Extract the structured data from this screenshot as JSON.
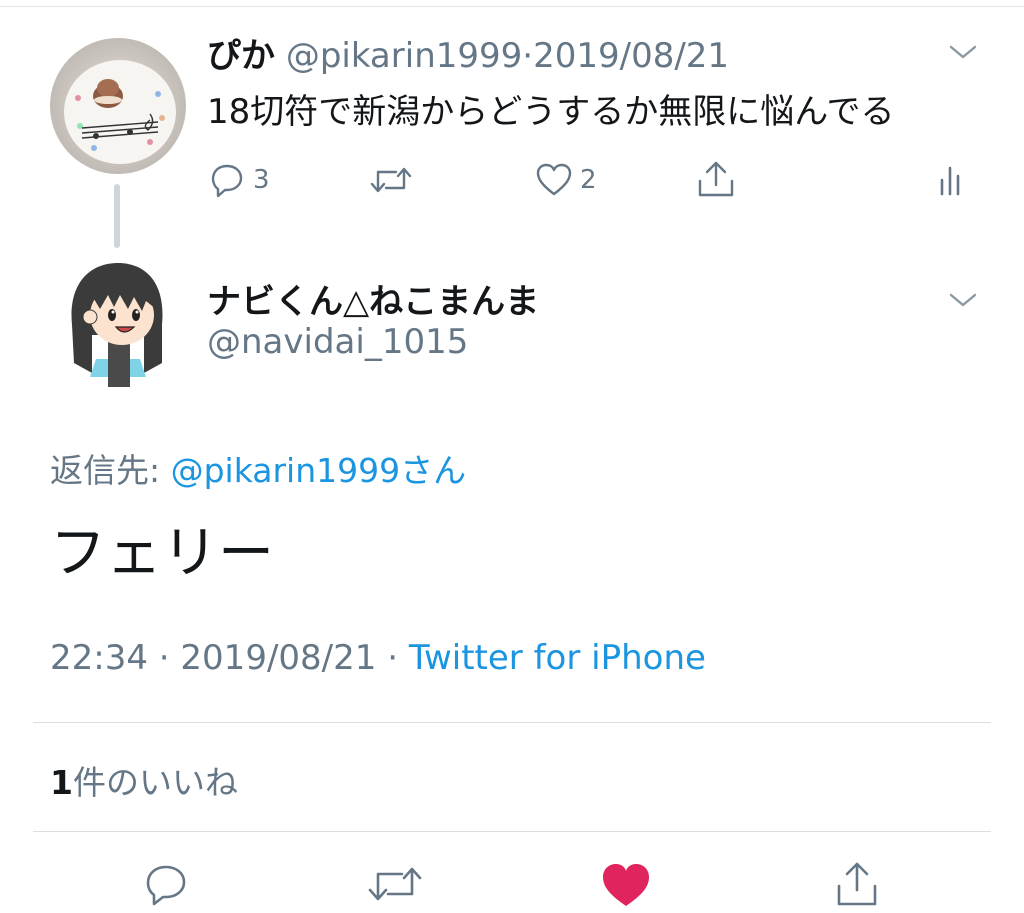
{
  "parent_tweet": {
    "name": "ぴか",
    "handle": "@pikarin1999",
    "separator": "·",
    "date": "2019/08/21",
    "text": "18切符で新潟からどうするか無限に悩んでる",
    "reply_count": "3",
    "like_count": "2"
  },
  "main_tweet": {
    "name": "ナビくん△ねこまんま",
    "handle": "@navidai_1015",
    "reply_prefix": "返信先: ",
    "reply_to": "@pikarin1999さん",
    "text": "フェリー",
    "time": "22:34",
    "separator": " · ",
    "date": "2019/08/21",
    "separator2": " · ",
    "source": "Twitter for iPhone",
    "likes_count": "1",
    "likes_label": "件のいいね"
  },
  "colors": {
    "accent": "#1b95e0",
    "secondary_text": "#657786",
    "like_red": "#e0245e"
  },
  "icons": [
    "chevron-down-icon",
    "reply-icon",
    "retweet-icon",
    "like-icon",
    "share-icon",
    "analytics-icon",
    "heart-filled-icon"
  ]
}
